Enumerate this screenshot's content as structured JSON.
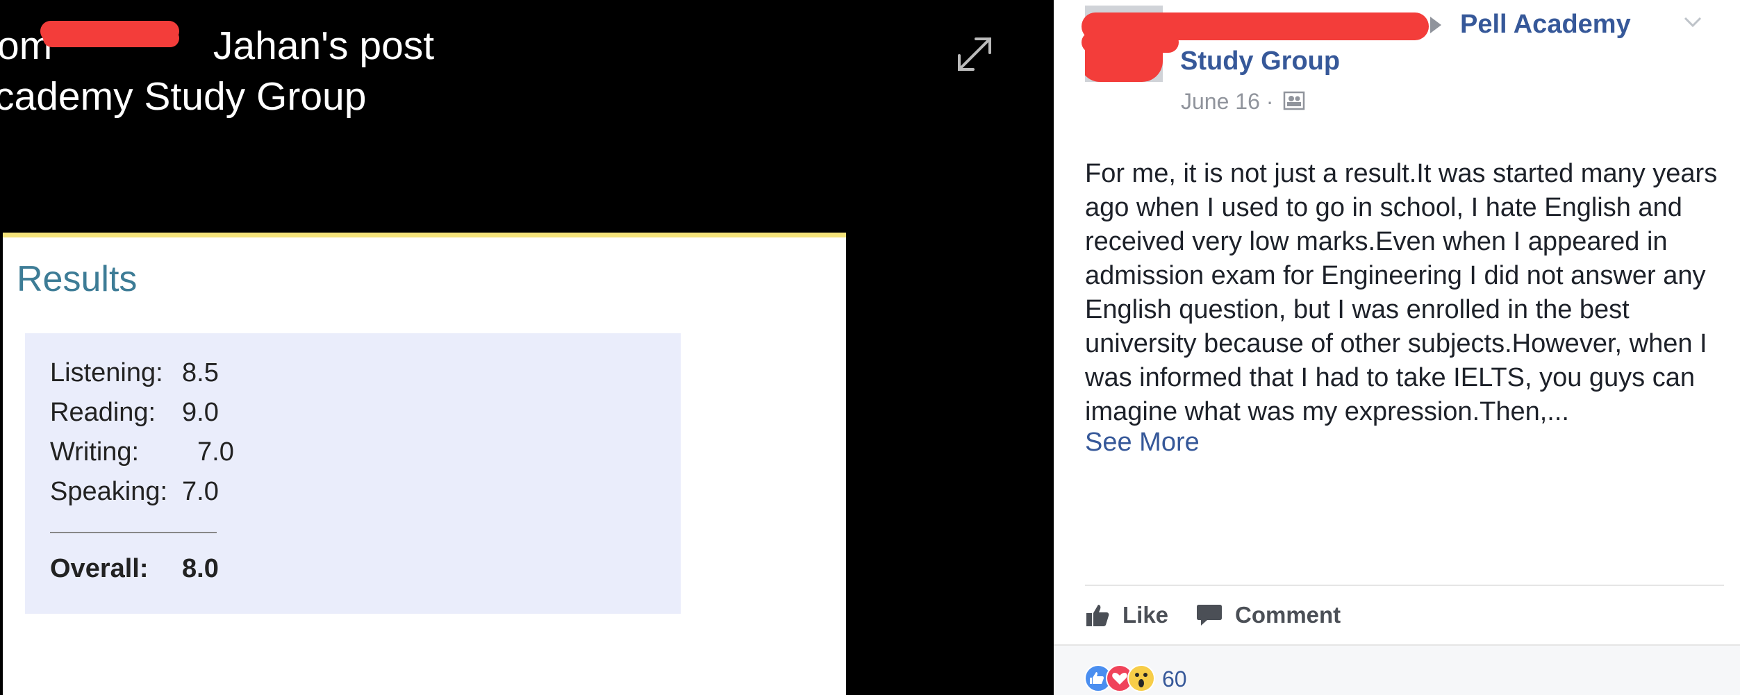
{
  "viewer": {
    "title_line1_part1": "om",
    "title_line1_part2": "Jahan's post",
    "title_line2": "cademy Study Group",
    "expand_icon": "expand-arrows-icon"
  },
  "results": {
    "heading": "Results",
    "scores": [
      {
        "label": "Listening:",
        "value": "8.5"
      },
      {
        "label": "Reading:",
        "value": "9.0"
      },
      {
        "label": "Writing:",
        "value": "7.0"
      },
      {
        "label": "Speaking:",
        "value": "7.0"
      }
    ],
    "overall_label": "Overall:",
    "overall_value": "8.0"
  },
  "post": {
    "group_line1": "Pell Academy",
    "group_line2": "Study Group",
    "date": "June 16 ·",
    "body": "For me, it is not just a result.It was started many years ago when I used to go in school, I hate English and received very low marks.Even when I appeared in admission exam for Engineering I did not answer any English question, but I was enrolled in the best university because of other subjects.However, when I was informed that I had to take IELTS, you guys can imagine what was my expression.Then,...",
    "see_more": "See More",
    "like_label": "Like",
    "comment_label": "Comment",
    "reaction_count": "60",
    "colors": {
      "link": "#365899",
      "redaction": "#f33d3a",
      "results_heading": "#3d7c96",
      "scores_bg": "#eaedfb"
    }
  }
}
